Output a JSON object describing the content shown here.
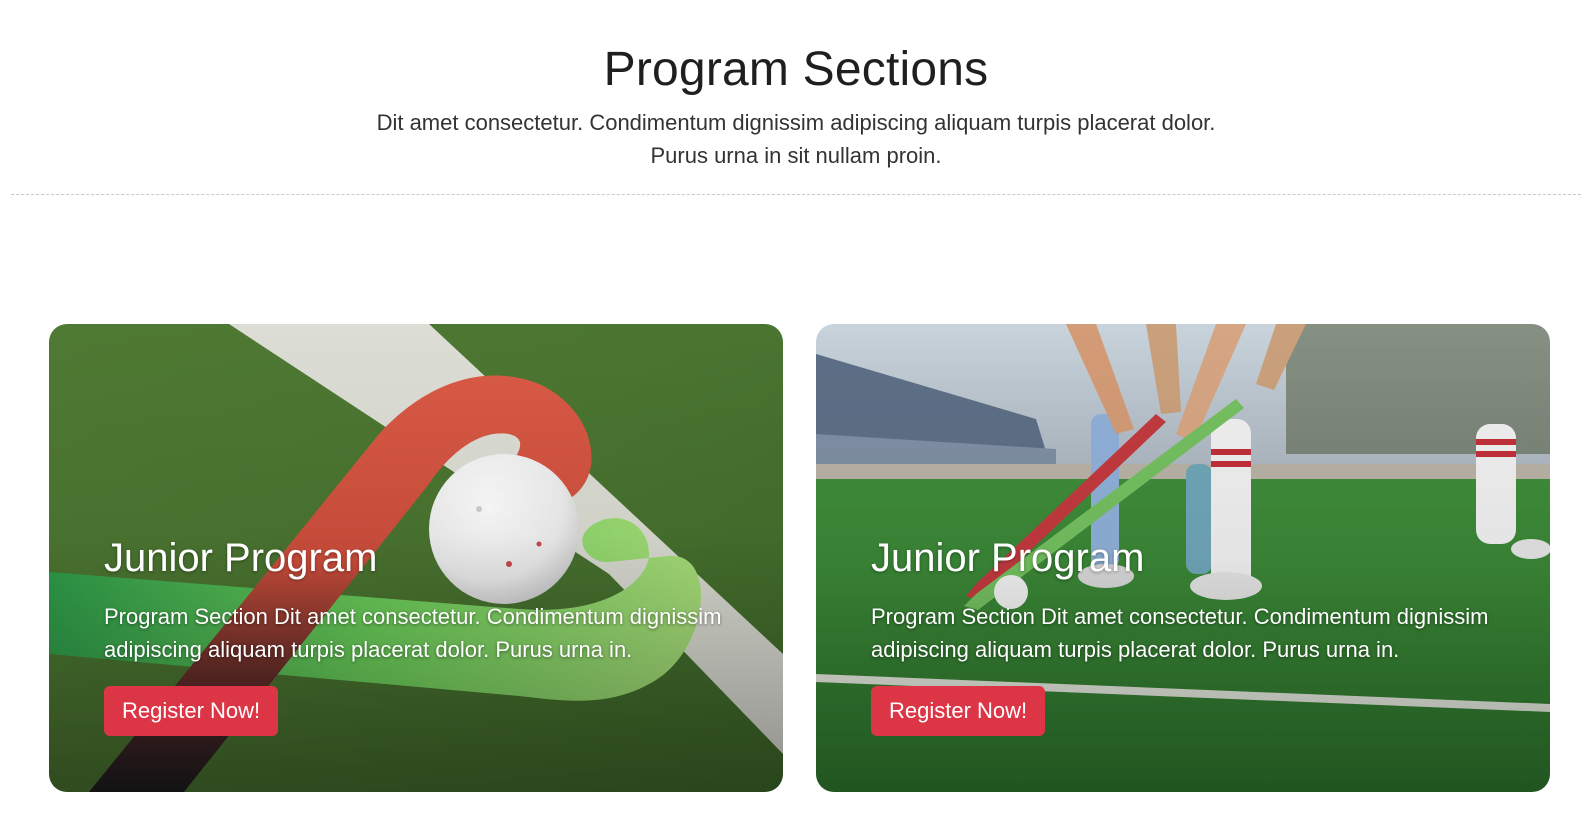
{
  "section": {
    "title": "Program Sections",
    "subtitle": "Dit amet consectetur. Condimentum dignissim adipiscing aliquam turpis placerat dolor. Purus urna in sit nullam proin."
  },
  "cards": [
    {
      "title": "Junior Program",
      "description": "Program Section Dit amet consectetur. Condimentum dignissim adipiscing aliquam turpis placerat dolor. Purus urna in.",
      "button_label": "Register Now!",
      "image": "hockey-sticks-and-ball-on-turf"
    },
    {
      "title": "Junior Program",
      "description": "Program Section Dit amet consectetur. Condimentum dignissim adipiscing aliquam turpis placerat dolor. Purus urna in.",
      "button_label": "Register Now!",
      "image": "players-in-field-hockey-game"
    }
  ],
  "colors": {
    "accent": "#dc3545",
    "title_text": "#1f1f1f",
    "body_text": "#333333",
    "divider": "#c9c9c9"
  }
}
